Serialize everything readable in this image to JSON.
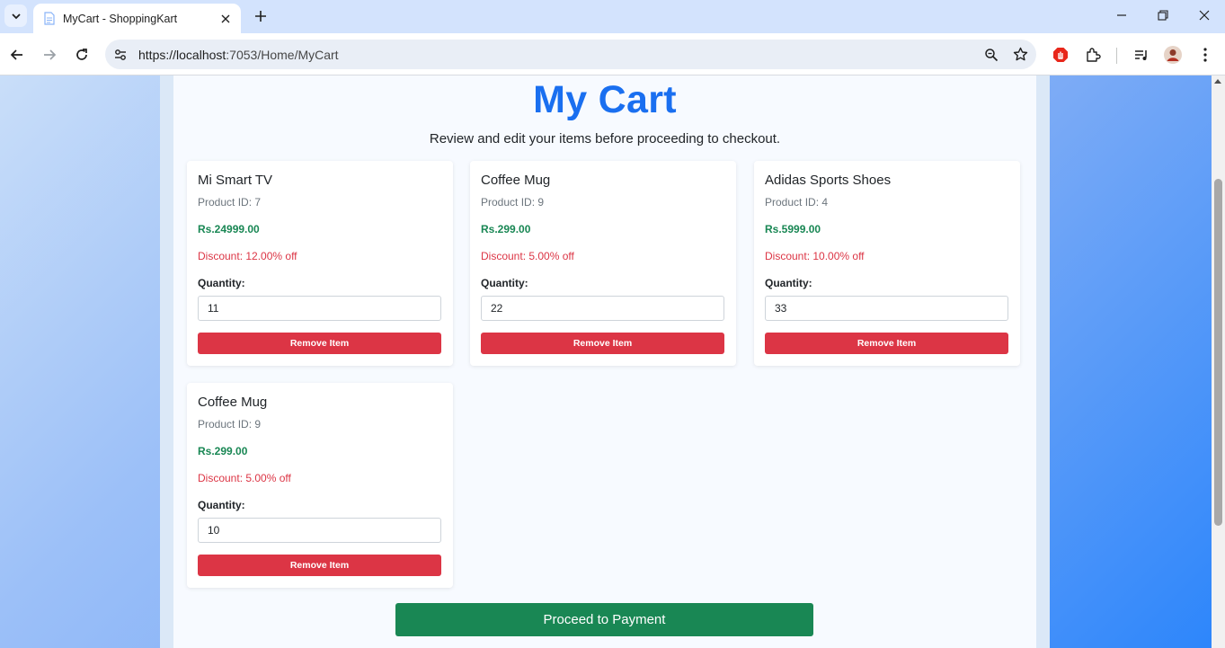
{
  "browser": {
    "tab_title": "MyCart - ShoppingKart",
    "url_scheme": "https://",
    "url_host": "localhost",
    "url_rest": ":7053/Home/MyCart"
  },
  "page": {
    "title": "My Cart",
    "subtitle": "Review and edit your items before proceeding to checkout.",
    "quantity_label": "Quantity:",
    "remove_label": "Remove Item",
    "pay_label": "Proceed to Payment"
  },
  "items": [
    {
      "name": "Mi Smart TV",
      "product_id": "Product ID: 7",
      "price": "Rs.24999.00",
      "discount": "Discount: 12.00% off",
      "quantity": "11"
    },
    {
      "name": "Coffee Mug",
      "product_id": "Product ID: 9",
      "price": "Rs.299.00",
      "discount": "Discount: 5.00% off",
      "quantity": "22"
    },
    {
      "name": "Adidas Sports Shoes",
      "product_id": "Product ID: 4",
      "price": "Rs.5999.00",
      "discount": "Discount: 10.00% off",
      "quantity": "33"
    },
    {
      "name": "Coffee Mug",
      "product_id": "Product ID: 9",
      "price": "Rs.299.00",
      "discount": "Discount: 5.00% off",
      "quantity": "10"
    }
  ],
  "colors": {
    "heading": "#1a6ff0",
    "price": "#198754",
    "discount": "#dc3545",
    "remove_button": "#dc3545",
    "pay_button": "#198754"
  }
}
